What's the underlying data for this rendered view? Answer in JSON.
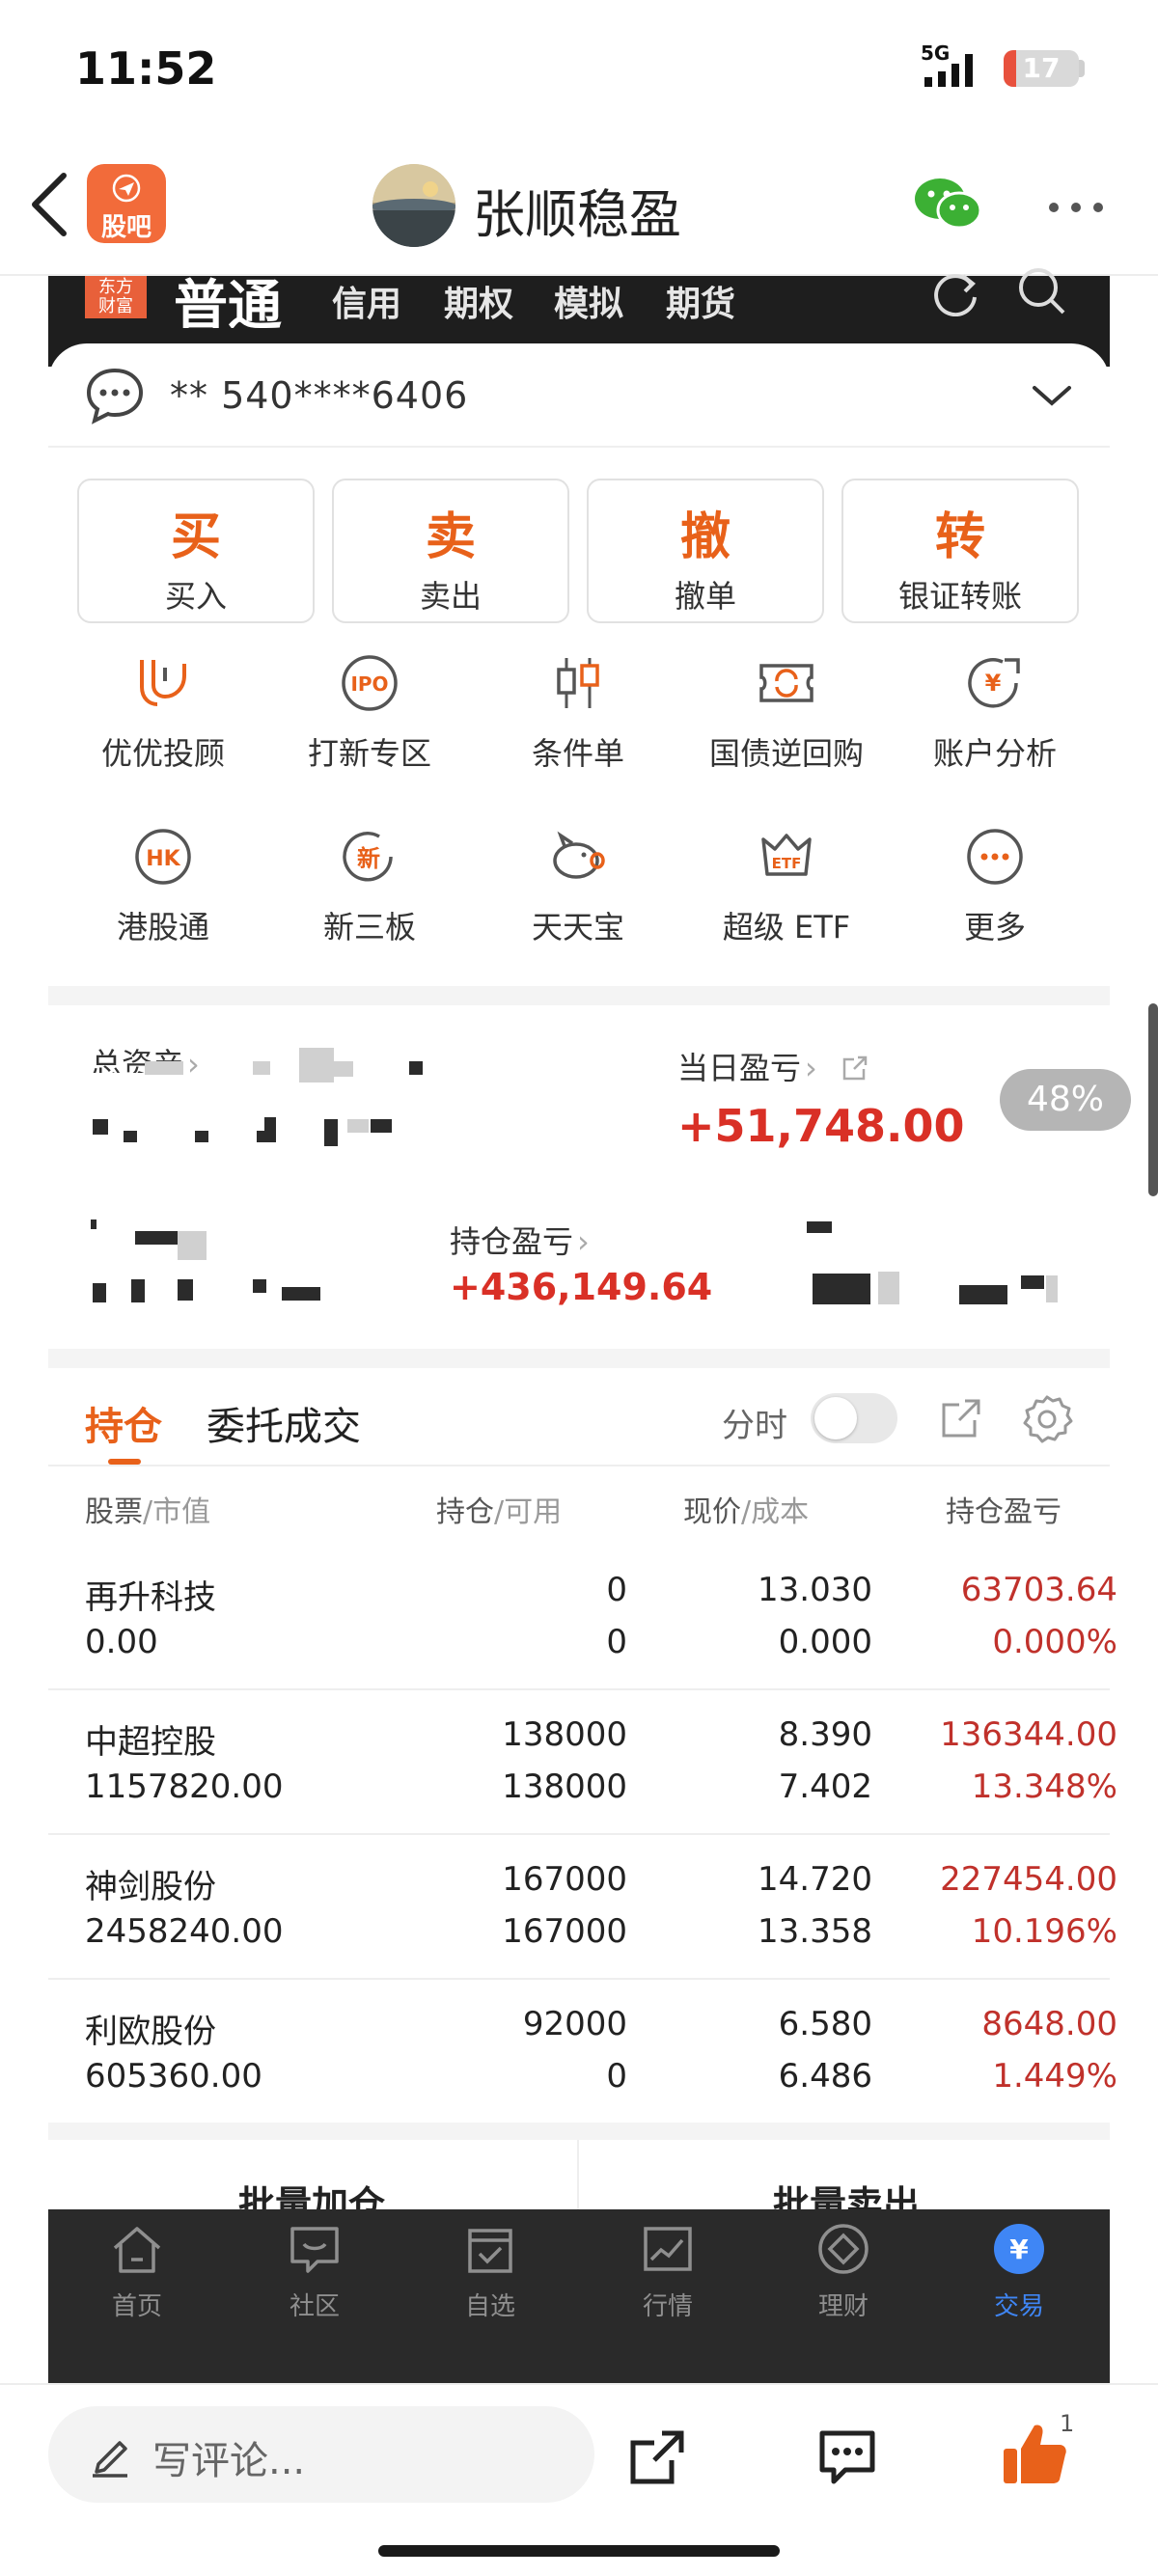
{
  "status_bar": {
    "time": "11:52",
    "network": "5G",
    "battery": "17",
    "battery_level": 0.17
  },
  "header": {
    "back_label": "",
    "logo_text_top": "",
    "logo_text_bottom": "股吧",
    "title": "张顺稳盈"
  },
  "trade_tabs": {
    "brand_top": "东方",
    "brand_bottom": "财富",
    "main": "普通",
    "others": [
      "信用",
      "期权",
      "模拟",
      "期货"
    ]
  },
  "account": {
    "masked_number": "** 540****6406"
  },
  "actions": [
    {
      "big": "买",
      "small": "买入"
    },
    {
      "big": "卖",
      "small": "卖出"
    },
    {
      "big": "撤",
      "small": "撤单"
    },
    {
      "big": "转",
      "small": "银证转账"
    }
  ],
  "grid_row1": [
    {
      "label": "优优投顾",
      "icon": "advisor-icon"
    },
    {
      "label": "打新专区",
      "icon": "ipo-icon",
      "icon_text": "IPO"
    },
    {
      "label": "条件单",
      "icon": "condition-order-icon"
    },
    {
      "label": "国债逆回购",
      "icon": "repo-icon"
    },
    {
      "label": "账户分析",
      "icon": "account-analysis-icon"
    }
  ],
  "grid_row2": [
    {
      "label": "港股通",
      "icon": "hk-icon",
      "icon_text": "HK"
    },
    {
      "label": "新三板",
      "icon": "neeq-icon",
      "icon_text": "新"
    },
    {
      "label": "天天宝",
      "icon": "piggy-icon"
    },
    {
      "label": "超级 ETF",
      "icon": "etf-icon",
      "icon_text": "ETF"
    },
    {
      "label": "更多",
      "icon": "more-dots-icon"
    }
  ],
  "assets": {
    "total_label": "总资产",
    "daily_label": "当日盈亏",
    "daily_value": "+51,748.00",
    "holding_label": "持仓盈亏",
    "holding_value": "+436,149.64",
    "percent_badge": "48%"
  },
  "holdings": {
    "tabs": [
      "持仓",
      "委托成交"
    ],
    "fenshi": "分时",
    "columns": [
      {
        "main": "股票",
        "sub": "/市值"
      },
      {
        "main": "持仓",
        "sub": "/可用"
      },
      {
        "main": "现价",
        "sub": "/成本"
      },
      {
        "main": "持仓盈亏",
        "sub": ""
      }
    ],
    "rows": [
      {
        "name": "再升科技",
        "market_value": "0.00",
        "position": "0",
        "available": "0",
        "price": "13.030",
        "cost": "0.000",
        "pl": "63703.64",
        "pl_pct": "0.000%"
      },
      {
        "name": "中超控股",
        "market_value": "1157820.00",
        "position": "138000",
        "available": "138000",
        "price": "8.390",
        "cost": "7.402",
        "pl": "136344.00",
        "pl_pct": "13.348%"
      },
      {
        "name": "神剑股份",
        "market_value": "2458240.00",
        "position": "167000",
        "available": "167000",
        "price": "14.720",
        "cost": "13.358",
        "pl": "227454.00",
        "pl_pct": "10.196%"
      },
      {
        "name": "利欧股份",
        "market_value": "605360.00",
        "position": "92000",
        "available": "0",
        "price": "6.580",
        "cost": "6.486",
        "pl": "8648.00",
        "pl_pct": "1.449%"
      }
    ]
  },
  "batch": {
    "add": "批量加仓",
    "sell": "批量卖出"
  },
  "inner_tabbar": [
    {
      "label": "首页",
      "icon": "home-icon"
    },
    {
      "label": "社区",
      "icon": "community-icon"
    },
    {
      "label": "自选",
      "icon": "watchlist-icon"
    },
    {
      "label": "行情",
      "icon": "market-icon"
    },
    {
      "label": "理财",
      "icon": "wealth-icon"
    },
    {
      "label": "交易",
      "icon": "trade-icon",
      "active": true
    }
  ],
  "comment_bar": {
    "placeholder": "写评论...",
    "like_count": "1"
  },
  "colors": {
    "accent": "#e8611a",
    "profit_red": "#d93026",
    "active_blue": "#3f86f5"
  }
}
